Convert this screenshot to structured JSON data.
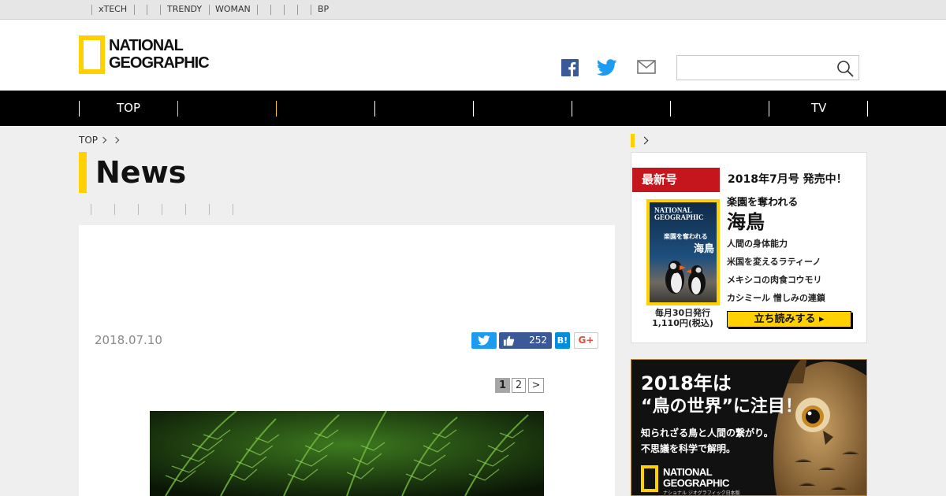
{
  "util_bar": {
    "links": [
      "xTECH",
      "TRENDY",
      "WOMAN",
      "BP"
    ]
  },
  "header": {
    "logo": {
      "line1": "NATIONAL",
      "line2": "GEOGRAPHIC"
    },
    "social_icons": [
      "facebook-icon",
      "twitter-icon",
      "mail-icon"
    ],
    "search": {
      "value": "",
      "placeholder": ""
    }
  },
  "nav": {
    "items": [
      "TOP",
      "TV"
    ]
  },
  "breadcrumb": {
    "home": "TOP"
  },
  "page": {
    "title": "News"
  },
  "article": {
    "date": "2018.07.10",
    "share": {
      "facebook_count": "252",
      "hatena_label": "B!",
      "gplus_label": "G+"
    },
    "pagination": {
      "pages": [
        "1",
        "2"
      ],
      "next": ">",
      "current": "1"
    }
  },
  "sidebar": {
    "magazine": {
      "tag": "最新号",
      "issue": "2018年7月号 発売中！",
      "headline_small": "楽園を奪われる",
      "headline_large": "海鳥",
      "toc": [
        "人間の身体能力",
        "米国を変えるラティーノ",
        "メキシコの肉食コウモリ",
        "カシミール 憎しみの連鎖"
      ],
      "pub_line1": "毎月30日発行",
      "pub_line2": "1,110円(税込)",
      "read_button": "立ち読みする ▸",
      "cover": {
        "logo1": "NATIONAL",
        "logo2": "GEOGRAPHIC",
        "text1": "楽園を奪われる",
        "text2": "海鳥"
      }
    },
    "banner": {
      "line1": "2018年は",
      "line2": "“鳥の世界”に注目！",
      "line3a": "知られざる鳥と人間の繋がり。",
      "line3b": "不思議を科学で解明。",
      "logo1": "NATIONAL",
      "logo2": "GEOGRAPHIC",
      "logo_sub": "ナショナル ジオグラフィック日本版"
    }
  },
  "colors": {
    "brand_yellow": "#ffd100",
    "nav_bg": "#000000",
    "twitter": "#1d9bf0",
    "facebook": "#3b5998",
    "hatena": "#008fde",
    "tag_red": "#c4161c"
  }
}
